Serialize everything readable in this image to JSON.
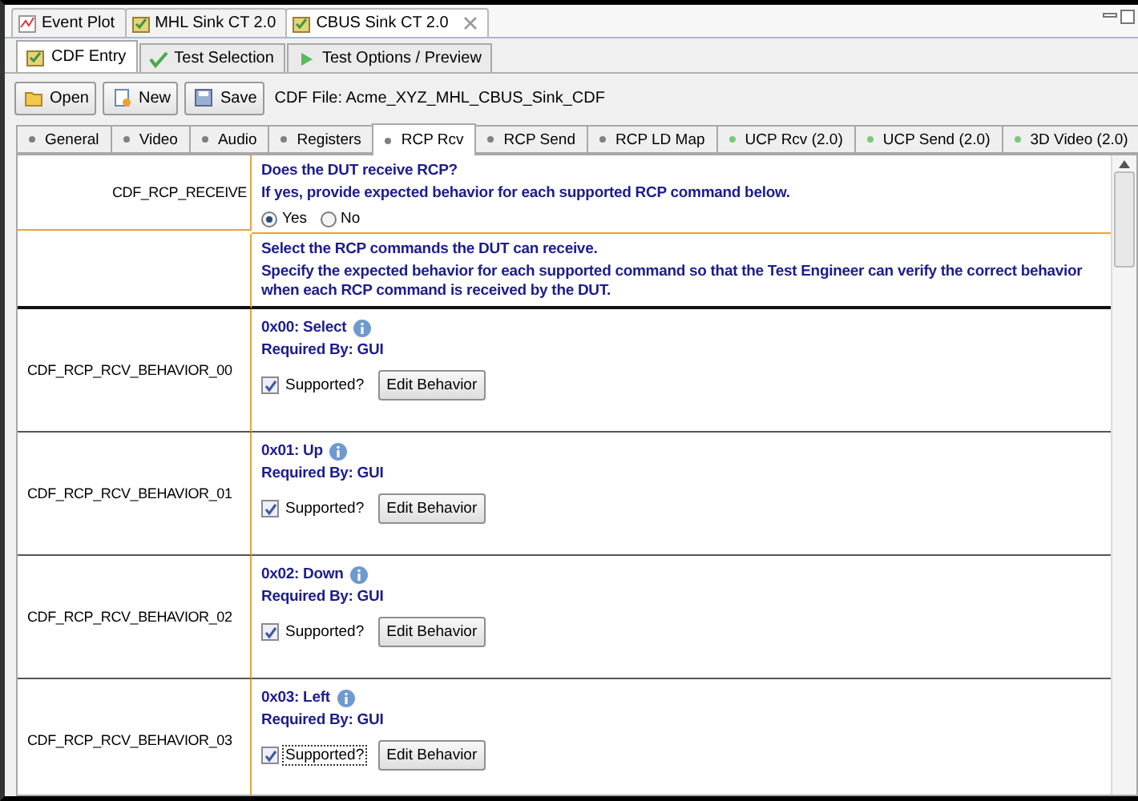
{
  "editor_tabs": [
    {
      "label": "Event Plot",
      "selected": false,
      "kind": "plot",
      "closable": false
    },
    {
      "label": "MHL Sink CT 2.0",
      "selected": false,
      "kind": "cdf",
      "closable": false
    },
    {
      "label": "CBUS Sink CT 2.0",
      "selected": true,
      "kind": "cdf",
      "closable": true
    }
  ],
  "view_tabs": [
    {
      "label": "CDF Entry",
      "selected": true,
      "kind": "cdf"
    },
    {
      "label": "Test Selection",
      "selected": false,
      "kind": "check"
    },
    {
      "label": "Test Options / Preview",
      "selected": false,
      "kind": "play"
    }
  ],
  "toolbar": {
    "buttons": [
      {
        "label": "Open",
        "kind": "open"
      },
      {
        "label": "New",
        "kind": "new"
      },
      {
        "label": "Save",
        "kind": "save"
      }
    ],
    "file_label": "CDF File: Acme_XYZ_MHL_CBUS_Sink_CDF"
  },
  "section_tabs": [
    {
      "label": "General",
      "selected": false,
      "color": "#808080"
    },
    {
      "label": "Video",
      "selected": false,
      "color": "#808080"
    },
    {
      "label": "Audio",
      "selected": false,
      "color": "#808080"
    },
    {
      "label": "Registers",
      "selected": false,
      "color": "#808080"
    },
    {
      "label": "RCP Rcv",
      "selected": true,
      "color": "#808080"
    },
    {
      "label": "RCP Send",
      "selected": false,
      "color": "#808080"
    },
    {
      "label": "RCP LD Map",
      "selected": false,
      "color": "#808080"
    },
    {
      "label": "UCP Rcv (2.0)",
      "selected": false,
      "color": "#7cc87c"
    },
    {
      "label": "UCP Send (2.0)",
      "selected": false,
      "color": "#7cc87c"
    },
    {
      "label": "3D Video (2.0)",
      "selected": false,
      "color": "#7cc87c"
    }
  ],
  "receive": {
    "key": "CDF_RCP_RECEIVE",
    "question": "Does the DUT receive RCP?",
    "hint": "If yes, provide expected behavior for each supported RCP command below.",
    "options": [
      {
        "label": "Yes",
        "selected": true
      },
      {
        "label": "No",
        "selected": false
      }
    ]
  },
  "intro": {
    "lead": "Select the RCP commands the DUT can receive.",
    "body": "Specify the expected behavior for each supported command so that the Test Engineer can verify the correct behavior when each RCP command is received by the DUT."
  },
  "behaviors": [
    {
      "key": "CDF_RCP_RCV_BEHAVIOR_00",
      "title": "0x00: Select",
      "required": "Required By: GUI",
      "supported": "Supported?",
      "checked": true,
      "focused": false,
      "button": "Edit Behavior"
    },
    {
      "key": "CDF_RCP_RCV_BEHAVIOR_01",
      "title": "0x01: Up",
      "required": "Required By: GUI",
      "supported": "Supported?",
      "checked": true,
      "focused": false,
      "button": "Edit Behavior"
    },
    {
      "key": "CDF_RCP_RCV_BEHAVIOR_02",
      "title": "0x02: Down",
      "required": "Required By: GUI",
      "supported": "Supported?",
      "checked": true,
      "focused": false,
      "button": "Edit Behavior"
    },
    {
      "key": "CDF_RCP_RCV_BEHAVIOR_03",
      "title": "0x03: Left",
      "required": "Required By: GUI",
      "supported": "Supported?",
      "checked": true,
      "focused": true,
      "button": "Edit Behavior"
    }
  ]
}
